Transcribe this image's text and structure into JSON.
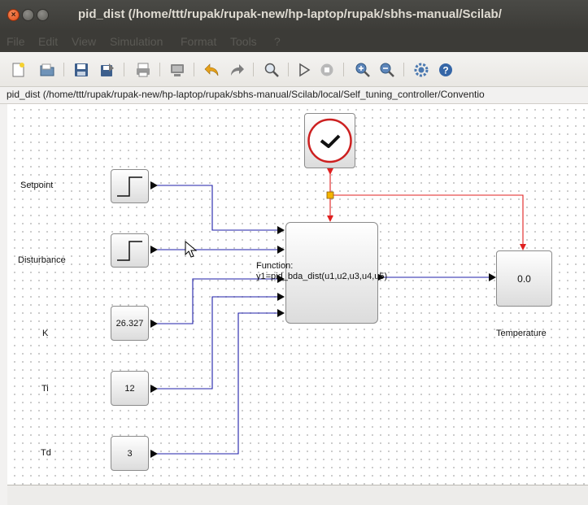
{
  "window": {
    "title": "pid_dist (/home/ttt/rupak/rupak-new/hp-laptop/rupak/sbhs-manual/Scilab/"
  },
  "menu": [
    "File",
    "Edit",
    "View",
    "Simulation",
    "Format",
    "Tools",
    "?"
  ],
  "toolbar": {
    "icons": [
      "new-diagram-icon",
      "open-icon",
      "save-icon",
      "save-as-icon",
      "print-icon",
      "export-icon",
      "undo-icon",
      "redo-icon",
      "fit-diagram-icon",
      "start-icon",
      "stop-icon",
      "zoom-in-icon",
      "zoom-out-icon",
      "setup-icon",
      "help-icon"
    ]
  },
  "path": "pid_dist (/home/ttt/rupak/rupak-new/hp-laptop/rupak/sbhs-manual/Scilab/local/Self_tuning_controller/Conventio",
  "diagram": {
    "labels": {
      "setpoint": "Setpoint",
      "disturbance": "Disturbance",
      "k": "K",
      "ti": "Ti",
      "td": "Td",
      "temperature": "Temperature"
    },
    "blocks": {
      "k_value": "26.327",
      "ti_value": "12",
      "td_value": "3",
      "display_value": "0.0"
    },
    "function": {
      "line1": "Function:",
      "line2": "y1=pid_bda_dist(u1,u2,u3,u4,u5)"
    }
  },
  "colors": {
    "signal_link": "#1f1fa8",
    "event_link": "#e02020",
    "clock_ring": "#cc2020",
    "split_point": "#f4b400"
  }
}
